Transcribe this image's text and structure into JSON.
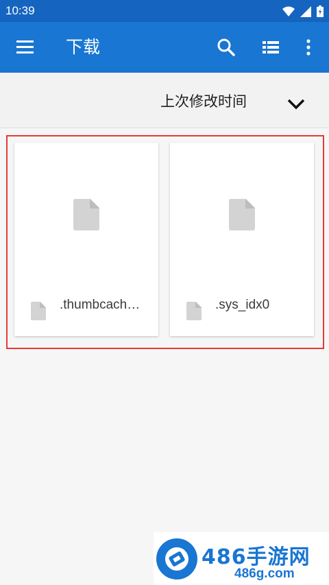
{
  "status_bar": {
    "time": "10:39",
    "icons": [
      "wifi-icon",
      "cell-signal-icon",
      "battery-icon"
    ]
  },
  "app_bar": {
    "title": "下载",
    "menu_icon": "menu-icon",
    "actions": [
      "search-icon",
      "list-view-icon",
      "more-vert-icon"
    ]
  },
  "sort_bar": {
    "label": "上次修改时间",
    "toggle_icon": "chevron-down-icon"
  },
  "files": [
    {
      "name": ".thumbcache",
      "display_name": ".thumbcach…",
      "icon": "file-icon"
    },
    {
      "name": ".sys_idx0",
      "display_name": ".sys_idx0",
      "icon": "file-icon"
    }
  ],
  "watermark": {
    "title": "486手游网",
    "url": "486g.com"
  },
  "colors": {
    "app_bar": "#1976d2",
    "status_bar": "#1565c0",
    "highlight_border": "#e53935",
    "file_icon": "#d3d3d3"
  }
}
